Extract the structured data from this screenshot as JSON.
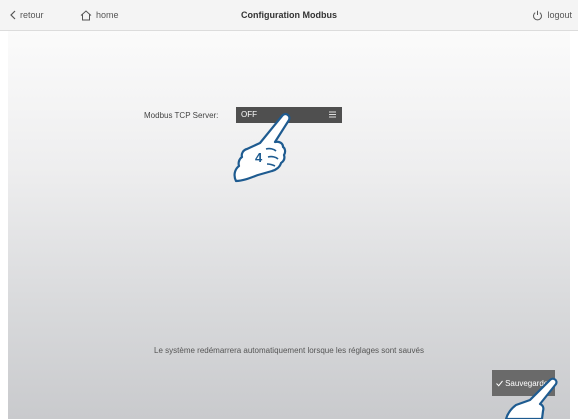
{
  "header": {
    "back_label": "retour",
    "home_label": "home",
    "title": "Configuration Modbus",
    "logout_label": "logout"
  },
  "form": {
    "modbus_label": "Modbus TCP Server:",
    "modbus_value": "OFF"
  },
  "footer": {
    "notice": "Le système redémarrera automatiquement lorsque les réglages sont sauvés",
    "save_label": "Sauvegarder"
  },
  "annotations": {
    "step_number": "4"
  },
  "icons": [
    "chevron-left-icon",
    "home-icon",
    "power-icon",
    "menu-icon",
    "checkmark-icon",
    "pointing-hand-icon"
  ],
  "colors": {
    "accent": "#1e5b90",
    "select_bg": "#4f4f4f",
    "button_bg": "#6a6a6a"
  }
}
